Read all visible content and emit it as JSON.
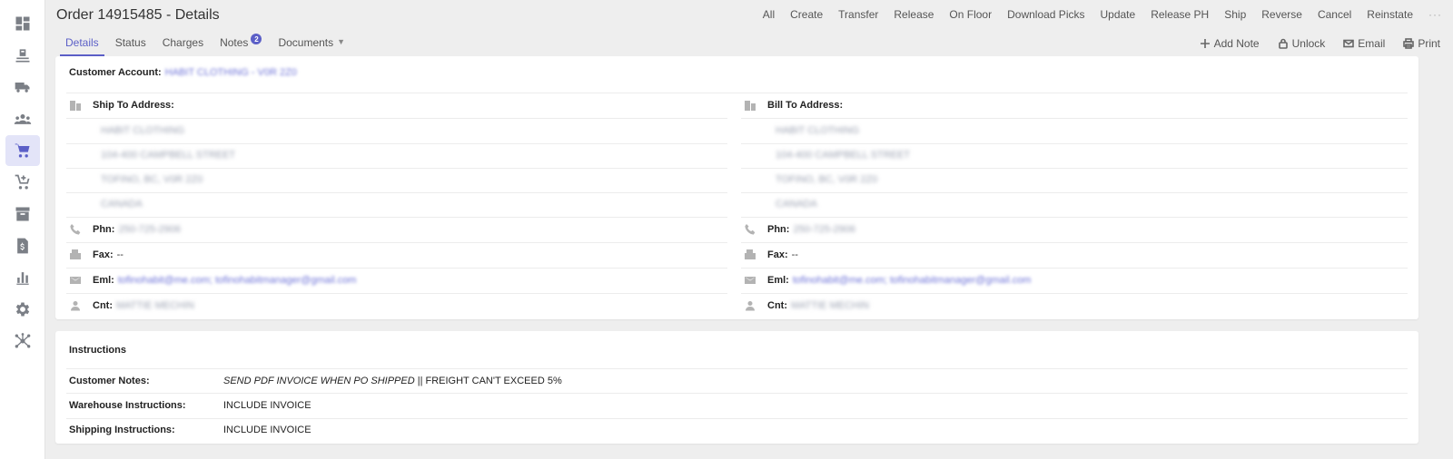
{
  "colors": {
    "accent": "#5b5fc7",
    "link": "#6f74d8",
    "background": "#eeeeee"
  },
  "sidebar": {
    "items": [
      {
        "icon": "dashboard-icon"
      },
      {
        "icon": "inbound-icon"
      },
      {
        "icon": "truck-icon"
      },
      {
        "icon": "users-icon"
      },
      {
        "icon": "cart-icon",
        "active": true
      },
      {
        "icon": "cart-plus-icon"
      },
      {
        "icon": "archive-icon"
      },
      {
        "icon": "invoice-icon"
      },
      {
        "icon": "bar-chart-icon"
      },
      {
        "icon": "gear-icon"
      },
      {
        "icon": "network-icon"
      }
    ]
  },
  "header": {
    "title": "Order 14915485 - Details",
    "actions": [
      "All",
      "Create",
      "Transfer",
      "Release",
      "On Floor",
      "Download Picks",
      "Update",
      "Release PH",
      "Ship",
      "Reverse",
      "Cancel",
      "Reinstate"
    ],
    "more": "···"
  },
  "tabs": [
    {
      "label": "Details",
      "active": true
    },
    {
      "label": "Status"
    },
    {
      "label": "Charges"
    },
    {
      "label": "Notes",
      "badge": "2"
    },
    {
      "label": "Documents",
      "dropdown": true
    }
  ],
  "tools": {
    "add_note": "Add Note",
    "unlock": "Unlock",
    "email": "Email",
    "print": "Print"
  },
  "customer": {
    "label": "Customer Account:",
    "value": "HABIT CLOTHING - V0R 2Z0"
  },
  "ship_to": {
    "label": "Ship To Address:",
    "lines": [
      "HABIT CLOTHING",
      "104-400 CAMPBELL STREET",
      "TOFINO, BC, V0R 2Z0",
      "CANADA"
    ],
    "phone_label": "Phn:",
    "phone": "250-725-2906",
    "fax_label": "Fax:",
    "fax": "--",
    "email_label": "Eml:",
    "email": "tofinohabit@me.com; tofinohabitmanager@gmail.com",
    "contact_label": "Cnt:",
    "contact": "MATTIE MECHIN"
  },
  "bill_to": {
    "label": "Bill To Address:",
    "lines": [
      "HABIT CLOTHING",
      "104-400 CAMPBELL STREET",
      "TOFINO, BC, V0R 2Z0",
      "CANADA"
    ],
    "phone_label": "Phn:",
    "phone": "250-725-2906",
    "fax_label": "Fax:",
    "fax": "--",
    "email_label": "Eml:",
    "email": "tofinohabit@me.com; tofinohabitmanager@gmail.com",
    "contact_label": "Cnt:",
    "contact": "MATTIE MECHIN"
  },
  "instructions": {
    "title": "Instructions",
    "customer_notes_label": "Customer Notes:",
    "customer_notes_italic": "SEND PDF INVOICE WHEN PO SHIPPED",
    "customer_notes_rest": " || FREIGHT CAN'T EXCEED 5%",
    "warehouse_label": "Warehouse Instructions:",
    "warehouse_value": "INCLUDE INVOICE",
    "shipping_label": "Shipping Instructions:",
    "shipping_value": "INCLUDE INVOICE"
  }
}
